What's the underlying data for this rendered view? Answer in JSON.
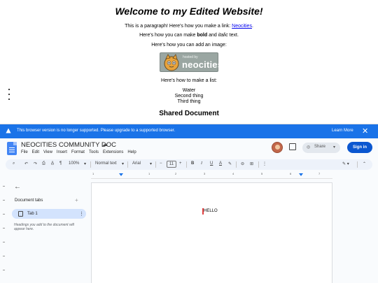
{
  "site": {
    "heading": "Welcome to my Edited Website!",
    "para_prefix": "This is a paragraph! Here's how you make a link: ",
    "link_text": "Neocities",
    "para_suffix": ".",
    "bold_pre": "Here's how you can make ",
    "bold_word": "bold",
    "bold_mid": " and ",
    "italic_word": "italic",
    "bold_post": " text.",
    "image_line": "Here's how you can add an image:",
    "badge_small": "hosted by",
    "badge_big": "neocities",
    "list_intro": "Here's how to make a list:",
    "list_items": [
      "Water",
      "Second thing",
      "Third thing"
    ],
    "shared_title": "Shared Document"
  },
  "banner": {
    "message": "This browser version is no longer supported. Please upgrade to a supported browser.",
    "learn_more": "Learn More"
  },
  "doc": {
    "title": "NEOCITIES COMMUNITY DOC",
    "menus": [
      "File",
      "Edit",
      "View",
      "Insert",
      "Format",
      "Tools",
      "Extensions",
      "Help"
    ],
    "share_label": "Share",
    "signin_label": "Sign in"
  },
  "toolbar": {
    "zoom": "100%",
    "style": "Normal text",
    "font": "Arial",
    "font_size": "11"
  },
  "ruler_numbers": [
    "1",
    "1",
    "2",
    "3",
    "4",
    "5",
    "6",
    "7"
  ],
  "sidebar": {
    "doc_tabs_label": "Document tabs",
    "tab_label": "Tab 1",
    "hint": "Headings you add to the document will appear here."
  },
  "page": {
    "body_text": "HELLO"
  },
  "colors": {
    "banner": "#1a73e8",
    "signin": "#0b57d0",
    "tab_selected": "#d3e3fd",
    "link": "#0000ee"
  }
}
